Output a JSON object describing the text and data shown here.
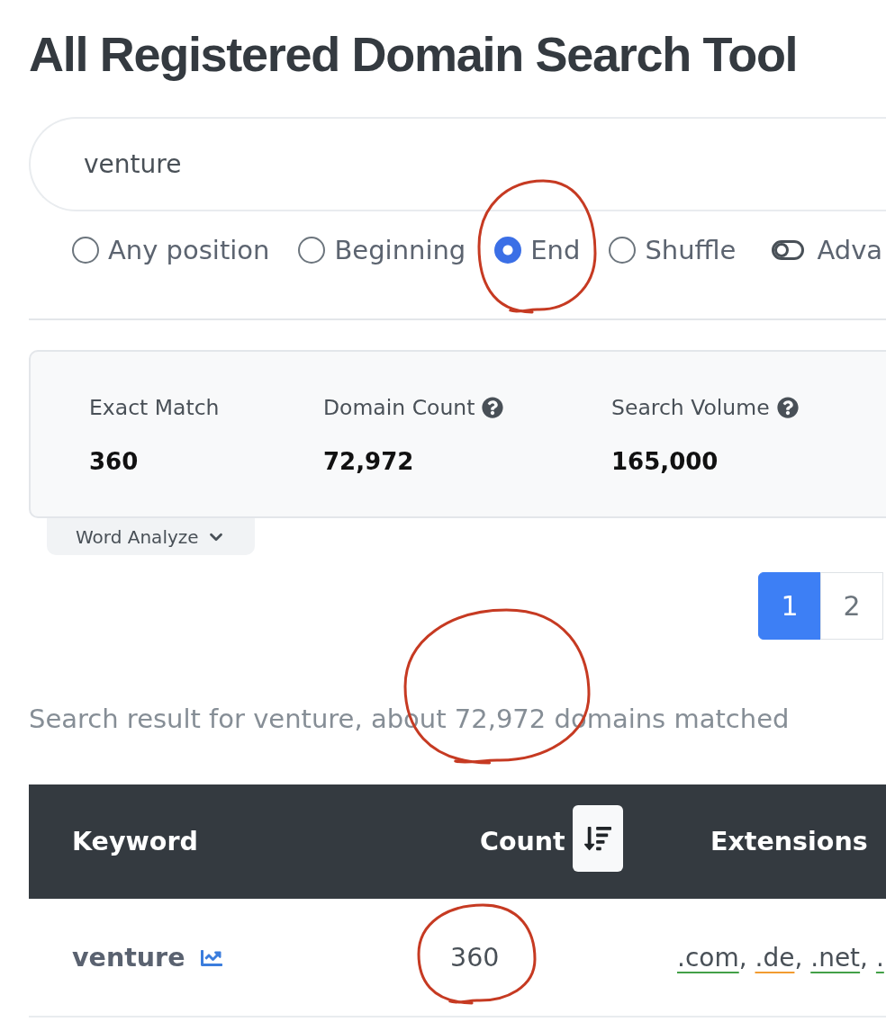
{
  "title": "All Registered Domain Search Tool",
  "search": {
    "value": "venture"
  },
  "match_modes": [
    {
      "label": "Any position",
      "selected": false,
      "circled": false
    },
    {
      "label": "Beginning",
      "selected": false,
      "circled": false
    },
    {
      "label": "End",
      "selected": true,
      "circled": true
    },
    {
      "label": "Shuffle",
      "selected": false,
      "circled": false
    }
  ],
  "advanced": {
    "label": "Adva",
    "on": false
  },
  "stats": [
    {
      "label": "Exact Match",
      "value": "360",
      "help": false
    },
    {
      "label": "Domain Count",
      "value": "72,972",
      "help": true
    },
    {
      "label": "Search Volume",
      "value": "165,000",
      "help": true
    }
  ],
  "word_analyze": {
    "label": "Word Analyze",
    "expanded": false
  },
  "pagination": [
    {
      "label": "1",
      "selected": true
    },
    {
      "label": "2",
      "selected": false
    }
  ],
  "summary": {
    "text": "Search result for venture, about 72,972 domains matched",
    "circled": true
  },
  "table": {
    "columns": [
      {
        "label": "Keyword",
        "sorted": false
      },
      {
        "label": "Count",
        "sorted": true
      },
      {
        "label": "Extensions",
        "sorted": false
      }
    ],
    "rows": [
      {
        "keyword": "venture",
        "count": "360",
        "count_circled": true,
        "separator": ",",
        "extensions": [
          {
            "text": ".com",
            "color": "#43a047"
          },
          {
            "text": ".de",
            "color": "#f29b30"
          },
          {
            "text": ".net",
            "color": "#43a047"
          },
          {
            "text": ".",
            "color": "#43a047"
          }
        ]
      }
    ]
  }
}
